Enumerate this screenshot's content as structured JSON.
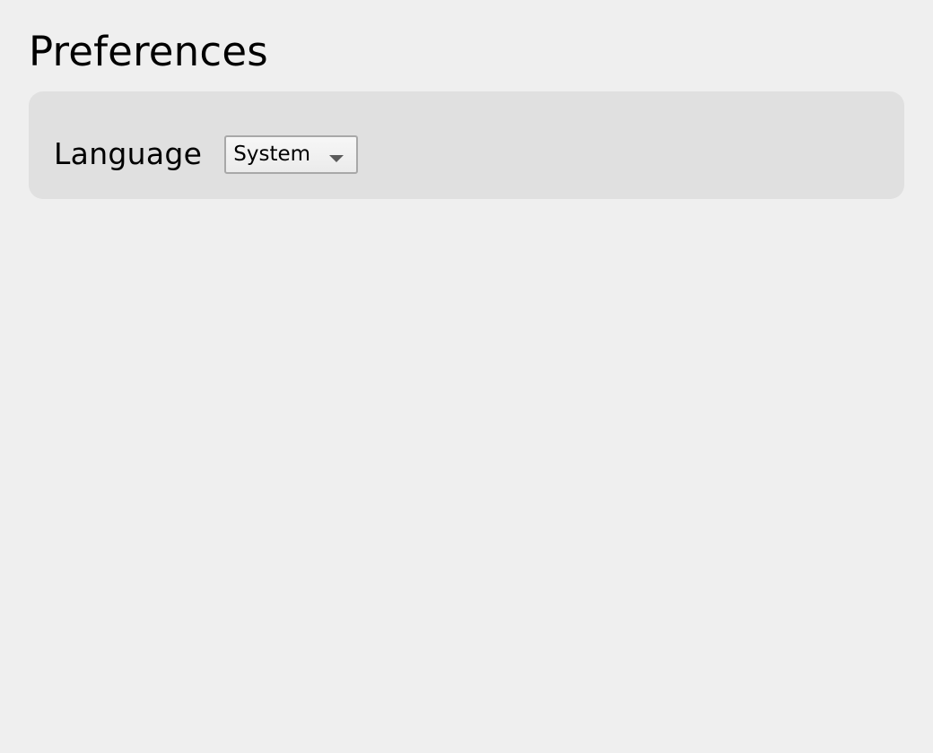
{
  "header": {
    "title": "Preferences"
  },
  "settings": {
    "language": {
      "label": "Language",
      "selected": "System",
      "icon": "chevron-down-icon"
    }
  }
}
